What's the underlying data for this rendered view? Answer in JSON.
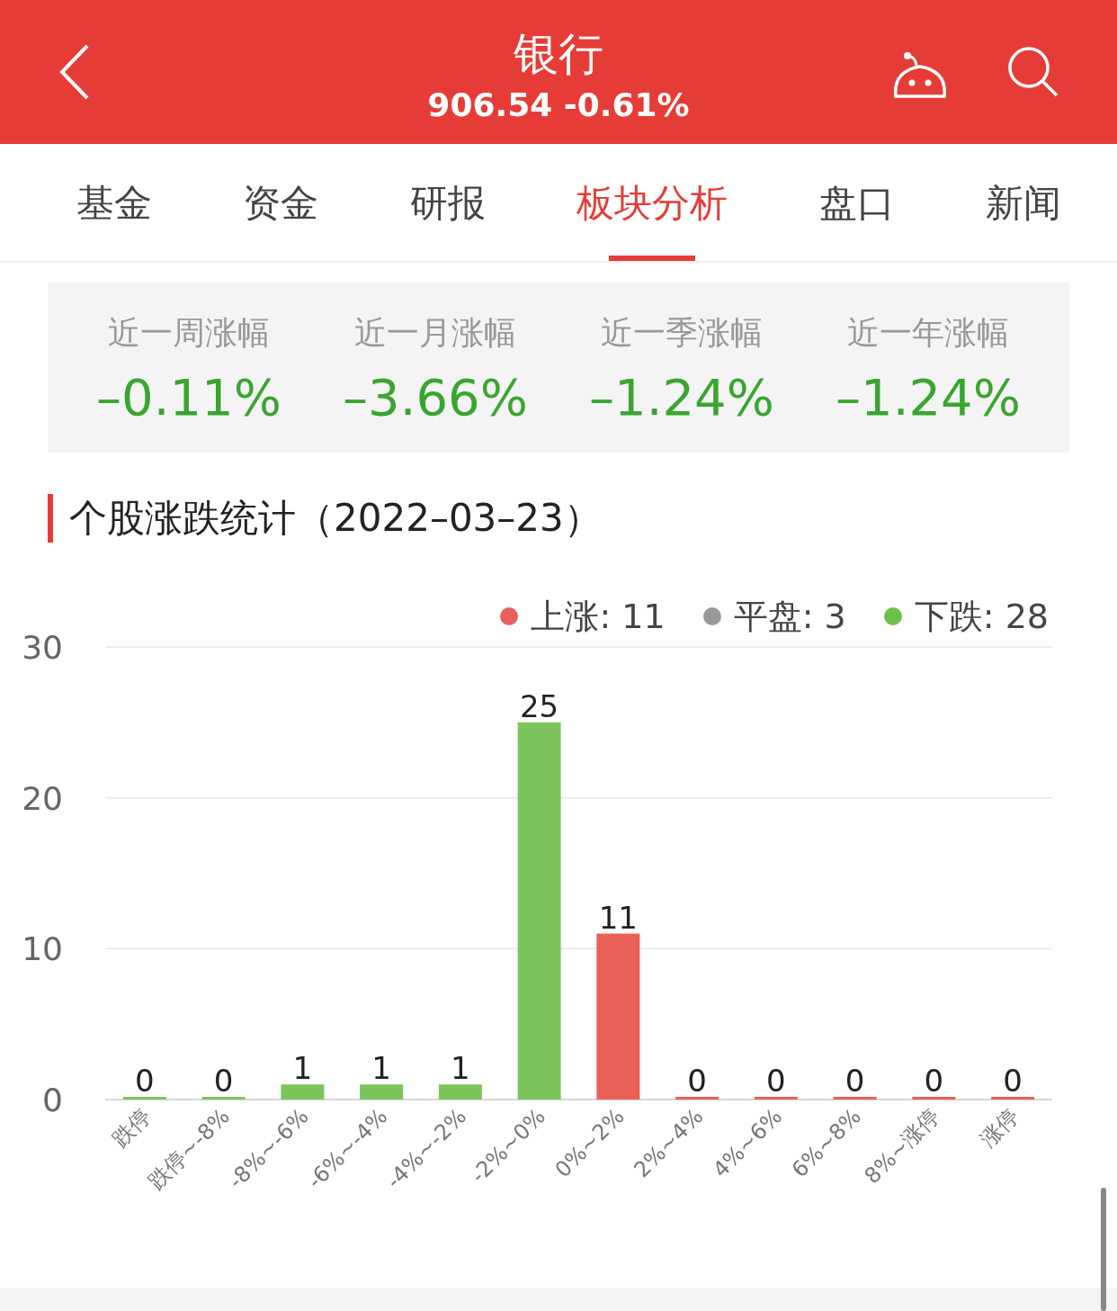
{
  "header": {
    "title": "银行",
    "quote": "906.54 -0.61%"
  },
  "tabs": [
    {
      "label": "基金",
      "selected": false
    },
    {
      "label": "资金",
      "selected": false
    },
    {
      "label": "研报",
      "selected": false
    },
    {
      "label": "板块分析",
      "selected": true
    },
    {
      "label": "盘口",
      "selected": false
    },
    {
      "label": "新闻",
      "selected": false
    }
  ],
  "stats": [
    {
      "label": "近一周涨幅",
      "value": "–0.11%"
    },
    {
      "label": "近一月涨幅",
      "value": "–3.66%"
    },
    {
      "label": "近一季涨幅",
      "value": "–1.24%"
    },
    {
      "label": "近一年涨幅",
      "value": "–1.24%"
    }
  ],
  "section_title": "个股涨跌统计（2022–03–23）",
  "legend": [
    {
      "label": "上涨: 11",
      "color": "#e8605a"
    },
    {
      "label": "平盘: 3",
      "color": "#999999"
    },
    {
      "label": "下跌: 28",
      "color": "#6cc04a"
    }
  ],
  "chart_data": {
    "type": "bar",
    "categories": [
      "跌停",
      "跌停~-8%",
      "-8%~-6%",
      "-6%~-4%",
      "-4%~-2%",
      "-2%~0%",
      "0%~2%",
      "2%~4%",
      "4%~6%",
      "6%~8%",
      "8%~涨停",
      "涨停"
    ],
    "series": [
      {
        "color": "#7bc55c",
        "values": [
          0,
          0,
          1,
          1,
          1,
          25,
          null,
          null,
          null,
          null,
          null,
          null
        ]
      },
      {
        "color": "#eb5f59",
        "values": [
          null,
          null,
          null,
          null,
          null,
          null,
          11,
          0,
          0,
          0,
          0,
          0
        ]
      }
    ],
    "ylim": [
      0,
      30
    ],
    "yticks": [
      0,
      10,
      20,
      30
    ],
    "data_labels": true
  }
}
